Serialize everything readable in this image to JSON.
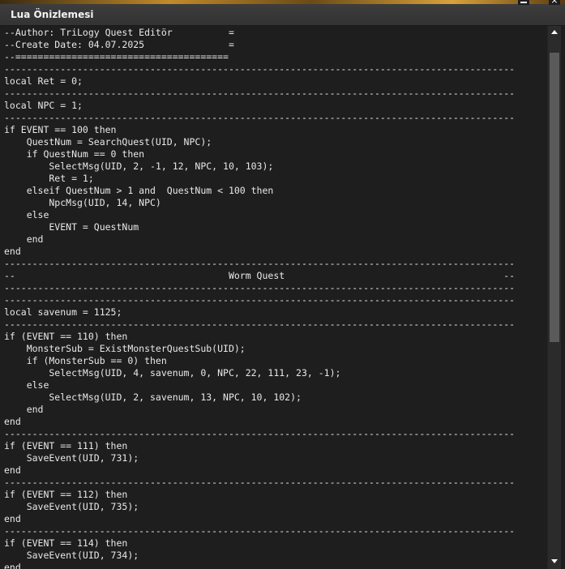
{
  "window": {
    "title": "Lua Önizlemesi",
    "minimize_glyph": "",
    "close_glyph": "×"
  },
  "editor": {
    "lines": [
      "--Author: TriLogy Quest Editör          =",
      "--Create Date: 04.07.2025               =",
      "--======================================",
      "-------------------------------------------------------------------------------------------",
      "local Ret = 0;",
      "-------------------------------------------------------------------------------------------",
      "local NPC = 1;",
      "-------------------------------------------------------------------------------------------",
      "if EVENT == 100 then",
      "    QuestNum = SearchQuest(UID, NPC);",
      "    if QuestNum == 0 then",
      "        SelectMsg(UID, 2, -1, 12, NPC, 10, 103);",
      "        Ret = 1;",
      "    elseif QuestNum > 1 and  QuestNum < 100 then",
      "        NpcMsg(UID, 14, NPC)",
      "    else",
      "        EVENT = QuestNum",
      "    end",
      "end",
      "-------------------------------------------------------------------------------------------",
      "--                                      Worm Quest                                       --",
      "-------------------------------------------------------------------------------------------",
      "-------------------------------------------------------------------------------------------",
      "local savenum = 1125;",
      "-------------------------------------------------------------------------------------------",
      "if (EVENT == 110) then",
      "    MonsterSub = ExistMonsterQuestSub(UID);",
      "    if (MonsterSub == 0) then",
      "        SelectMsg(UID, 4, savenum, 0, NPC, 22, 111, 23, -1);",
      "    else",
      "        SelectMsg(UID, 2, savenum, 13, NPC, 10, 102);",
      "    end",
      "end",
      "-------------------------------------------------------------------------------------------",
      "if (EVENT == 111) then",
      "    SaveEvent(UID, 731);",
      "end",
      "-------------------------------------------------------------------------------------------",
      "if (EVENT == 112) then",
      "    SaveEvent(UID, 735);",
      "end",
      "-------------------------------------------------------------------------------------------",
      "if (EVENT == 114) then",
      "    SaveEvent(UID, 734);",
      "end"
    ]
  },
  "colors": {
    "background": "#1e1e1e",
    "text": "#e8e8e8",
    "titlebar": "#333333",
    "scroll_thumb": "#5a5a5a"
  },
  "icons": {
    "minimize": "minimize-icon",
    "close": "close-icon",
    "scroll_up": "arrow-up-icon",
    "scroll_down": "arrow-down-icon"
  }
}
